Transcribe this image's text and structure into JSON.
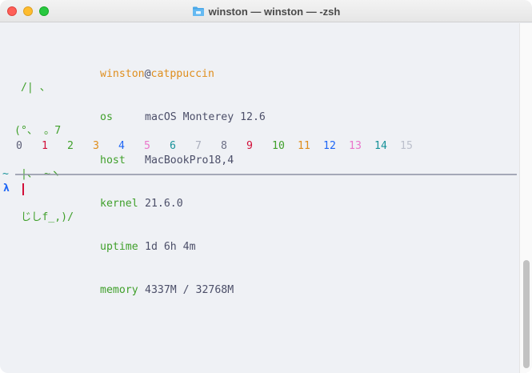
{
  "window": {
    "title": "winston — winston — -zsh"
  },
  "fetch": {
    "user": "winston",
    "at": "@",
    "hostname": "catppuccin",
    "ascii_art": [
      " /| 、",
      "(°、 。7",
      " |、 ~ヽ",
      " じしf_,)/"
    ],
    "rows": [
      {
        "key": "os",
        "value": "macOS Monterey 12.6"
      },
      {
        "key": "host",
        "value": "MacBookPro18,4"
      },
      {
        "key": "kernel",
        "value": "21.6.0"
      },
      {
        "key": "uptime",
        "value": "1d 6h 4m"
      },
      {
        "key": "memory",
        "value": "4337M / 32768M"
      }
    ]
  },
  "palette": {
    "labels": [
      "0",
      "1",
      "2",
      "3",
      "4",
      "5",
      "6",
      "7",
      "8",
      "9",
      "10",
      "11",
      "12",
      "13",
      "14",
      "15"
    ],
    "colors": [
      "#5c5f77",
      "#d20f39",
      "#40a02b",
      "#df8e1d",
      "#1e66f5",
      "#ea76cb",
      "#179299",
      "#acb0be",
      "#6c6f85",
      "#d20f39",
      "#40a02b",
      "#df8e1d",
      "#1e66f5",
      "#ea76cb",
      "#179299",
      "#bcc0cc"
    ]
  },
  "prompt": {
    "dir_symbol": "~",
    "prompt_symbol": "λ"
  },
  "icons": {
    "folder": "folder-icon"
  }
}
